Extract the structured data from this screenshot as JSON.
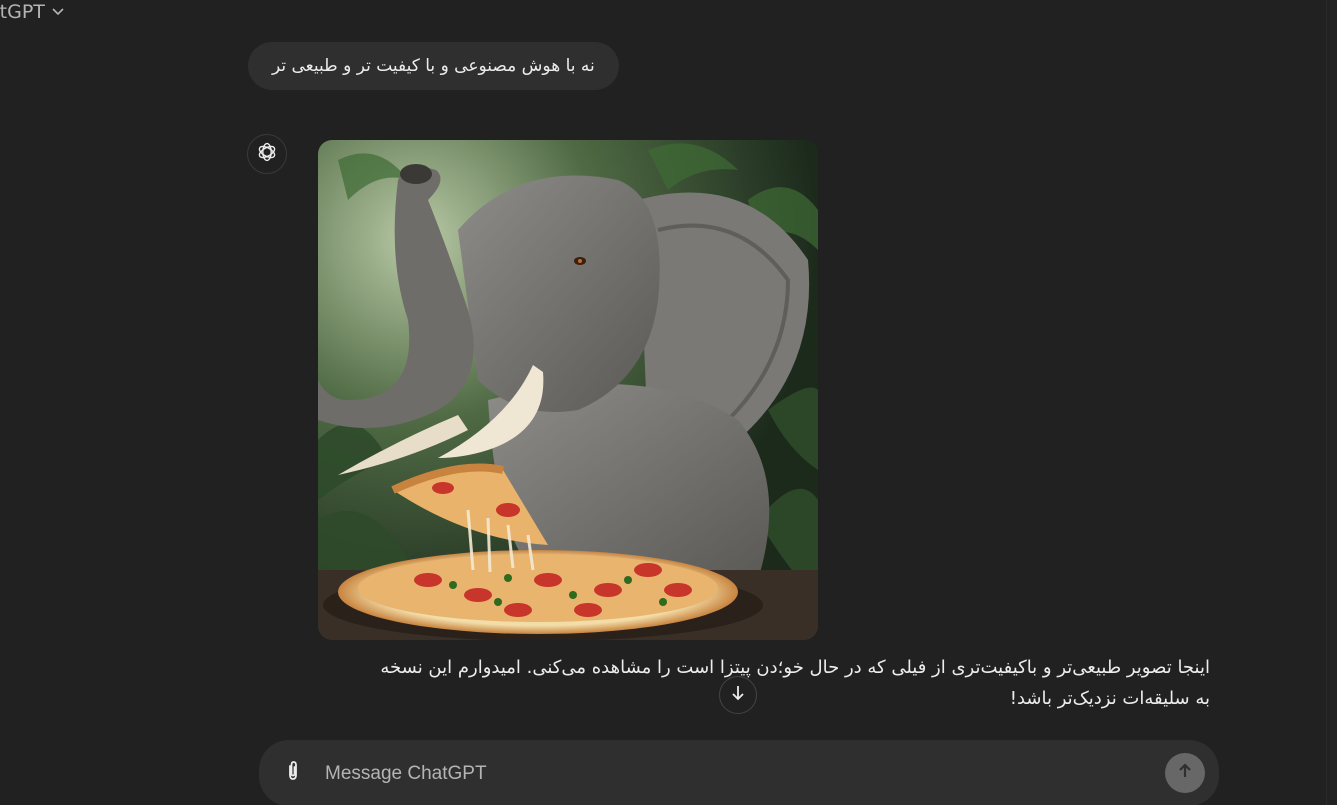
{
  "header": {
    "model_name": "atGPT",
    "dropdown_icon": "chevron-down-icon"
  },
  "conversation": {
    "user_message": "نه با هوش مصنوعی و با کیفیت تر و طبیعی تر",
    "assistant": {
      "avatar_icon": "openai-logo-icon",
      "image_icon": "generated-image",
      "reply_line_1": "اینجا تصویر طبیعی‌تر و باکیفیت‌تری از فیلی که در حال خو؛دن پیتزا است را مشاهده می‌کنی. امیدوارم این نسخه",
      "reply_line_2": "به سلیقه‌ات نزدیک‌تر باشد!"
    }
  },
  "scroll_down_icon": "arrow-down-icon",
  "composer": {
    "placeholder": "Message ChatGPT",
    "value": "",
    "attach_icon": "paperclip-icon",
    "send_icon": "arrow-up-icon"
  },
  "colors": {
    "background": "#212121",
    "bubble": "#2f2f2f",
    "text": "#ececec",
    "muted": "#b4b4b4",
    "send_button": "#676767"
  }
}
